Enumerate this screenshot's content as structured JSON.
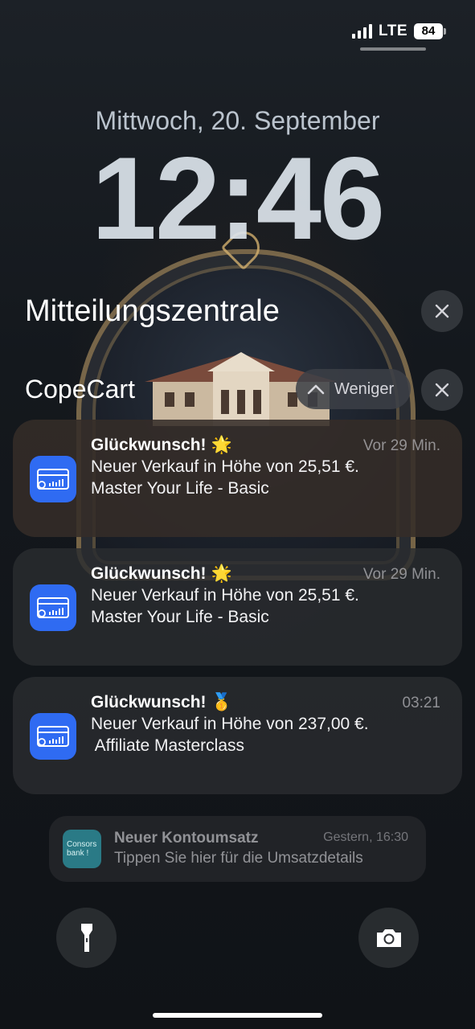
{
  "status_bar": {
    "network": "LTE",
    "battery": "84",
    "signal_bars": 4
  },
  "lockscreen": {
    "date": "Mittwoch, 20. September",
    "time": "12:46"
  },
  "notification_center": {
    "title": "Mitteilungszentrale",
    "group": {
      "app_name": "CopeCart",
      "collapse_label": "Weniger"
    }
  },
  "notifications": [
    {
      "title": "Glückwunsch!",
      "emoji": "🌟",
      "time": "Vor 29 Min.",
      "line1": "Neuer Verkauf in Höhe von 25,51 €.",
      "line2": "Master Your Life - Basic",
      "icon": "credit-card-chart-icon"
    },
    {
      "title": "Glückwunsch!",
      "emoji": "🌟",
      "time": "Vor 29 Min.",
      "line1": "Neuer Verkauf in Höhe von 25,51 €.",
      "line2": "Master Your Life - Basic",
      "icon": "credit-card-chart-icon"
    },
    {
      "title": "Glückwunsch!",
      "emoji": "🥇",
      "time": "03:21",
      "line1": "Neuer Verkauf in Höhe von 237,00 €.",
      "line2": " Affiliate Masterclass",
      "icon": "credit-card-chart-icon"
    }
  ],
  "bank_notification": {
    "app_icon_text_1": "Consors",
    "app_icon_text_2": "bank !",
    "title": "Neuer Kontoumsatz",
    "time": "Gestern, 16:30",
    "text": "Tippen Sie hier für die Umsatzdetails"
  },
  "colors": {
    "app_icon_blue": "#2f6bf2",
    "bank_teal": "#2a7a86"
  }
}
